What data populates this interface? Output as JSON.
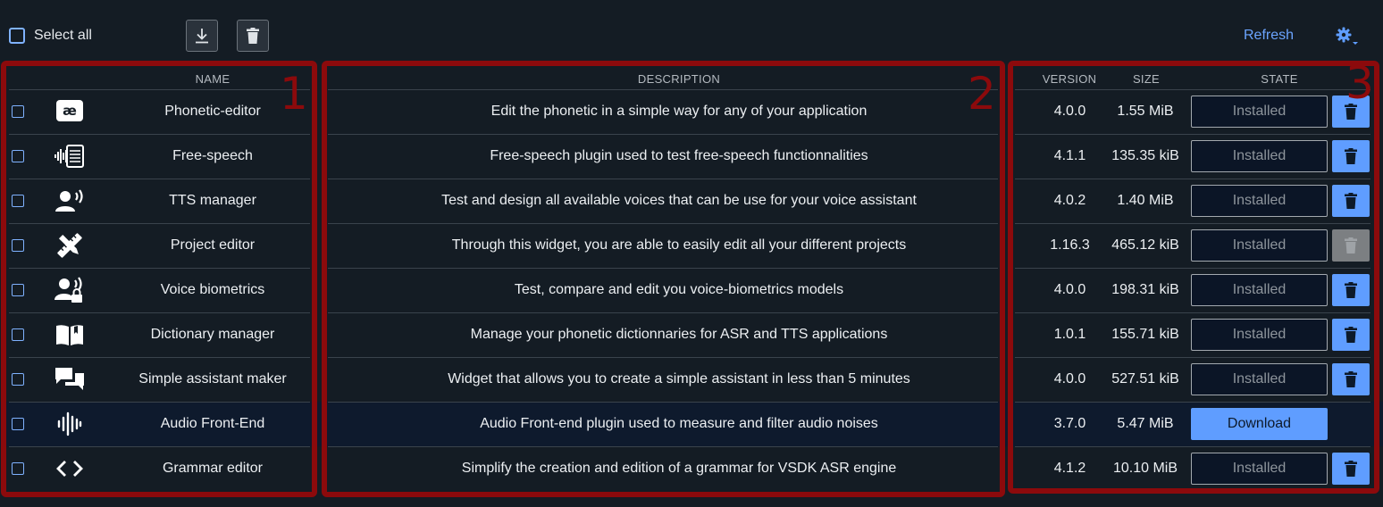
{
  "toolbar": {
    "select_all_label": "Select all",
    "download_icon": "download-icon",
    "delete_icon": "trash-icon",
    "refresh_label": "Refresh",
    "settings_icon": "gear-icon"
  },
  "headers": {
    "name": "NAME",
    "description": "DESCRIPTION",
    "version": "VERSION",
    "size": "SIZE",
    "state": "STATE"
  },
  "rows": [
    {
      "icon": "phonetic-ae-icon",
      "name": "Phonetic-editor",
      "description": "Edit the phonetic in a simple way for any of your application",
      "version": "4.0.0",
      "size": "1.55 MiB",
      "state": "Installed",
      "delete": "enabled"
    },
    {
      "icon": "waveform-document-icon",
      "name": "Free-speech",
      "description": "Free-speech plugin used to test free-speech functionnalities",
      "version": "4.1.1",
      "size": "135.35 kiB",
      "state": "Installed",
      "delete": "enabled"
    },
    {
      "icon": "person-speaking-icon",
      "name": "TTS manager",
      "description": "Test and design all available voices that can be use for your voice assistant",
      "version": "4.0.2",
      "size": "1.40 MiB",
      "state": "Installed",
      "delete": "enabled"
    },
    {
      "icon": "pencil-ruler-icon",
      "name": "Project editor",
      "description": "Through this widget, you are able to easily edit all your different projects",
      "version": "1.16.3",
      "size": "465.12 kiB",
      "state": "Installed",
      "delete": "disabled"
    },
    {
      "icon": "person-voice-lock-icon",
      "name": "Voice biometrics",
      "description": "Test, compare and edit you voice-biometrics models",
      "version": "4.0.0",
      "size": "198.31 kiB",
      "state": "Installed",
      "delete": "enabled"
    },
    {
      "icon": "open-book-icon",
      "name": "Dictionary manager",
      "description": "Manage your phonetic dictionnaries for ASR and TTS applications",
      "version": "1.0.1",
      "size": "155.71 kiB",
      "state": "Installed",
      "delete": "enabled"
    },
    {
      "icon": "chat-bubbles-icon",
      "name": "Simple assistant maker",
      "description": "Widget that allows you to create a simple assistant in less than 5 minutes",
      "version": "4.0.0",
      "size": "527.51 kiB",
      "state": "Installed",
      "delete": "enabled"
    },
    {
      "icon": "audio-bars-icon",
      "name": "Audio Front-End",
      "description": "Audio Front-end plugin used to measure and filter audio noises",
      "version": "3.7.0",
      "size": "5.47 MiB",
      "state": "Download",
      "delete": "none"
    },
    {
      "icon": "code-brackets-icon",
      "name": "Grammar editor",
      "description": "Simplify the creation and edition of a grammar for VSDK ASR engine",
      "version": "4.1.2",
      "size": "10.10 MiB",
      "state": "Installed",
      "delete": "enabled"
    }
  ],
  "annotations": [
    "1",
    "2",
    "3"
  ],
  "colors": {
    "background": "#141c24",
    "accent": "#5f9dff",
    "annotation": "#8c0a0c",
    "highlight_row": "#0e1a2d"
  }
}
